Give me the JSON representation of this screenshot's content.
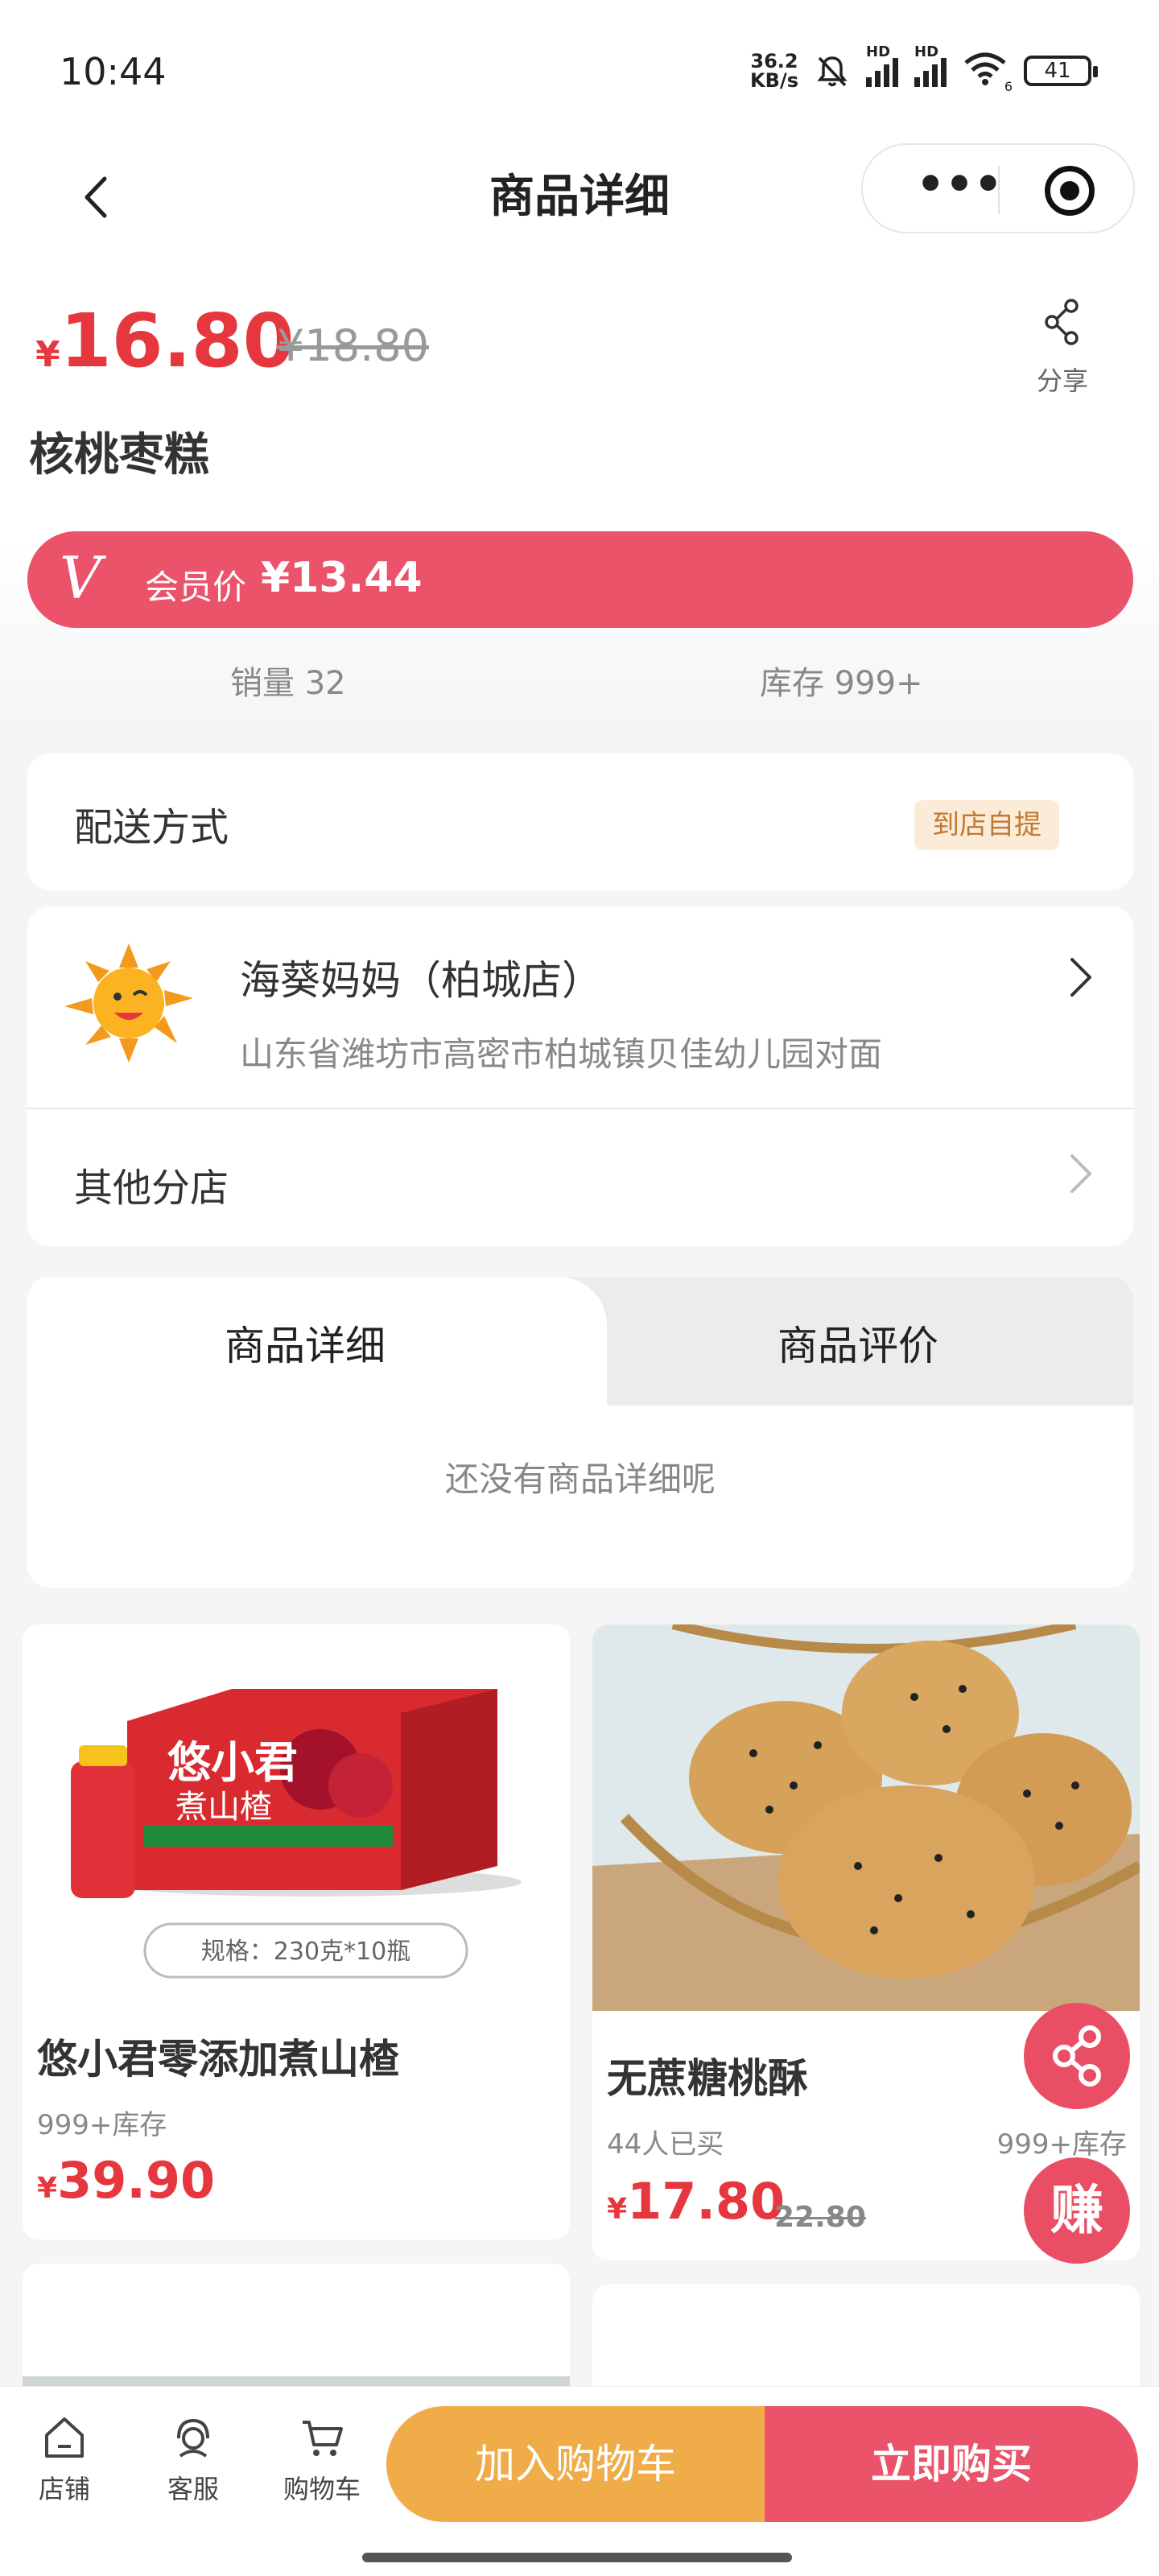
{
  "status_bar": {
    "time": "10:44",
    "net_speed_value": "36.2",
    "net_speed_unit": "KB/s",
    "hd1": "HD",
    "hd2": "HD",
    "wifi_badge": "6",
    "battery": "41"
  },
  "nav": {
    "title": "商品详细",
    "more_icon": "•••"
  },
  "product": {
    "currency": "¥",
    "price": "16.80",
    "original_price": "¥18.80",
    "name": "核桃枣糕",
    "share_label": "分享",
    "member_v": "V",
    "member_label": "会员价",
    "member_price": "¥13.44",
    "sales": "销量 32",
    "stock": "库存 999+"
  },
  "delivery": {
    "label": "配送方式",
    "tag": "到店自提"
  },
  "store": {
    "name": "海葵妈妈（柏城店）",
    "address": "山东省潍坊市高密市柏城镇贝佳幼儿园对面",
    "other_label": "其他分店"
  },
  "tabs": {
    "detail": "商品详细",
    "review": "商品评价",
    "empty_text": "还没有商品详细呢"
  },
  "recommend": [
    {
      "name": "悠小君零添加煮山楂",
      "meta": "999+库存",
      "currency": "¥",
      "price": "39.90",
      "img_brand": "悠小君",
      "img_sub": "煮山楂",
      "img_spec": "规格：230克*10瓶"
    },
    {
      "name": "无蔗糖桃酥",
      "meta": "44人已买",
      "meta_right": "999+库存",
      "currency": "¥",
      "price": "17.80",
      "old_price": "22.80"
    }
  ],
  "fab": {
    "earn_label": "赚"
  },
  "bottom_bar": {
    "shop": "店铺",
    "service": "客服",
    "cart": "购物车",
    "add_cart": "加入购物车",
    "buy_now": "立即购买"
  },
  "colors": {
    "accent": "#e6373f",
    "member": "#ea5369",
    "cart_btn": "#f0ac48"
  }
}
